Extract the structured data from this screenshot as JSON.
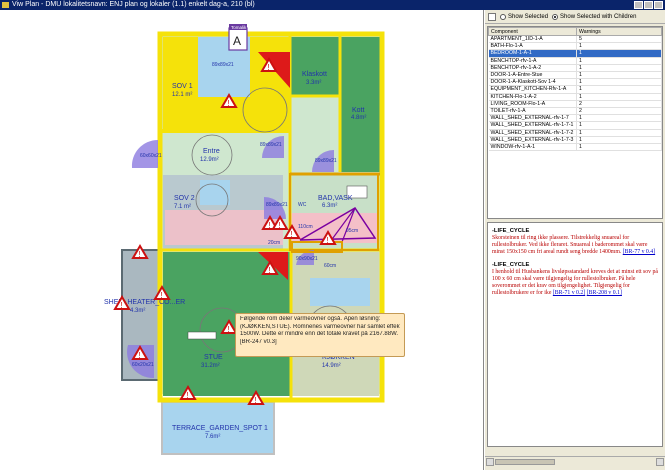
{
  "window": {
    "title": "Viw Plan - DMU lokalitetsnavn: ENJ plan og lokaler (1.1) enkelt dag-a, 210 (bl)"
  },
  "floor_tag": {
    "label": "Tomalik",
    "letter": "A"
  },
  "rooms": [
    {
      "name": "SOV 1",
      "area": "12.1 m²"
    },
    {
      "name": "Klaskott",
      "area": "3.3m²"
    },
    {
      "name": "Kott",
      "area": "4.8m²"
    },
    {
      "name": "Entre",
      "area": "12.9m²"
    },
    {
      "name": "SOV 2",
      "area": "7.1 m²"
    },
    {
      "name": "BAD,VASK",
      "area": "6.3m²"
    },
    {
      "name": "SHED_HEATER_CO...ER",
      "area": "4.3m²"
    },
    {
      "name": "STUE",
      "area": "31.2m²"
    },
    {
      "name": "KJØKKEN",
      "area": "14.9m²"
    },
    {
      "name": "TERRACE_GARDEN_SPOT 1",
      "area": "7.6m²"
    }
  ],
  "small_labels": {
    "door1": "60x60x21",
    "door2": "89x89x21",
    "door3": "89x89x21",
    "door4": "89x89x21",
    "door5": "60x20x21",
    "door6": "90x90x21",
    "door7": "89x89x21",
    "dim_a": "110cm",
    "dim_b": "95cm",
    "dim_c": "60cm",
    "dim_d": "20cm",
    "wc": "WC"
  },
  "tooltip": {
    "lines": [
      "Følgende rom deler varmeovner også. Åpen løsning:",
      "(KJØKKEN,STUE). Romnenes varmeovner har samlet effekt på",
      "1500W. Dette er mindre enn det totale kravet på 2167.88W.",
      "[BR-247 v0.3]"
    ]
  },
  "toolbar": {
    "show_selected": "Show Selected",
    "show_children": "Show Selected with Children"
  },
  "table": {
    "headers": [
      "Component",
      "Warnings"
    ],
    "rows": [
      [
        "APARTMENT_1ID-1-A",
        "5"
      ],
      [
        "BATH-Flo-1-A",
        "1"
      ],
      [
        "BEDROOM-1-A-1",
        "1"
      ],
      [
        "BENCHTOP-rfv-1-A",
        "1"
      ],
      [
        "BENCHTOP-rfv-1-A-2",
        "1"
      ],
      [
        "DOOR-1-A-Entre-Stue",
        "1"
      ],
      [
        "DOOR-1-A-Klaskott-Sov 1-4",
        "1"
      ],
      [
        "EQUIPMENT_KITCHEN-Rfv-1-A",
        "1"
      ],
      [
        "KITCHEN-Flo-1-A-2",
        "1"
      ],
      [
        "LIVING_ROOM-Flo-1-A",
        "2"
      ],
      [
        "TOILET-rfv-1-A",
        "2"
      ],
      [
        "WALL_SHED_EXTERNAL-rfv-1-7",
        "1"
      ],
      [
        "WALL_SHED_EXTERNAL-rfv-1-7-1",
        "1"
      ],
      [
        "WALL_SHED_EXTERNAL-rfv-1-7-2",
        "1"
      ],
      [
        "WALL_SHED_EXTERNAL-rfv-1-7-3",
        "1"
      ],
      [
        "WINDOW-rfv-1-A-1",
        "1"
      ]
    ],
    "selected_index": 2
  },
  "rules": [
    {
      "heading": "-LIFE_CYCLE",
      "body": "Skorsteinen til ring ikke plassere. Tilstrekkelig snuareal for rullestolbruker. Ved ikke fleraret. Snuareal i baderommet skal være minst 150x150 cm fri areal rundt seng bredde 1400mm.",
      "ref": "[BR-77 v 0.4]"
    },
    {
      "heading": "-LIFE_CYCLE",
      "body": "I henhold til Husbankens livsløpsstandard kreves det at minst ett sov på 100 x 60 cm skal være tilgjengelig for rullestolbruker. På hele soverommet er det krav om tilgjengelighet. Tilgjengelig for rullestolbrukere er for ike",
      "ref": "[BR-71 v 0.2]",
      "ref2": "[BR-208 v 0.1]"
    }
  ],
  "colors": {
    "wall": "#f5e20a",
    "room_green": "#4aa361",
    "room_blue": "#a8d4ee",
    "room_lightgreen": "#cfe7cf",
    "room_gray": "#aab8c0",
    "room_pink": "#f4c0c8",
    "door_purple": "#8c7ae0",
    "warning_red": "#cc1111",
    "selection": "#316ac5"
  }
}
